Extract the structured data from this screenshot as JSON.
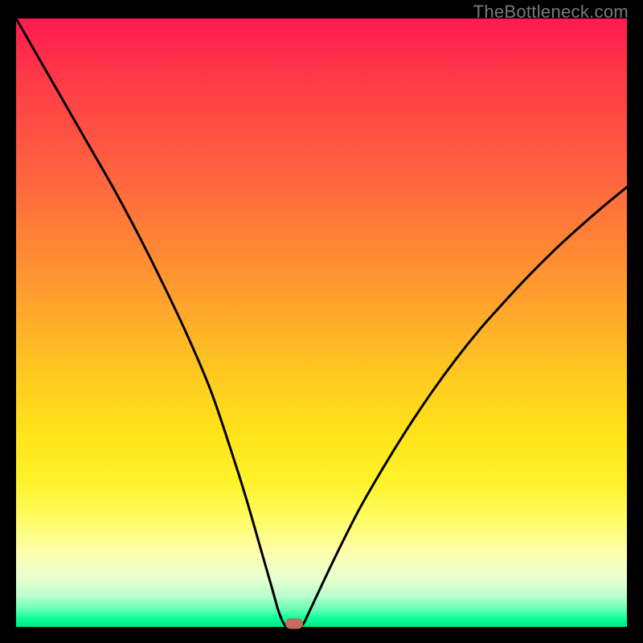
{
  "watermark": "TheBottleneck.com",
  "colors": {
    "curve_stroke": "#000000",
    "marker_fill": "#c86a60",
    "gradient_top": "#ff1a4f",
    "gradient_bottom": "#00e689",
    "frame": "#000000"
  },
  "chart_data": {
    "type": "line",
    "title": "",
    "xlabel": "",
    "ylabel": "",
    "xlim": [
      0,
      100
    ],
    "ylim": [
      0,
      100
    ],
    "grid": false,
    "legend": false,
    "series": [
      {
        "name": "bottleneck-curve",
        "x": [
          0,
          4,
          8,
          12,
          16,
          20,
          24,
          28,
          32,
          36,
          38,
          40,
          42,
          43,
          44,
          45,
          46,
          47,
          48,
          52,
          56,
          60,
          64,
          68,
          72,
          76,
          80,
          84,
          88,
          92,
          96,
          100
        ],
        "values": [
          100,
          93,
          86,
          79,
          72,
          64.5,
          56.5,
          48,
          38.5,
          26.5,
          20,
          13,
          6,
          2.5,
          0.3,
          0.2,
          0.2,
          0.5,
          2.5,
          11,
          19,
          26,
          32.5,
          38.5,
          44,
          49,
          53.5,
          57.8,
          61.8,
          65.5,
          69,
          72.3
        ]
      }
    ],
    "marker": {
      "x": 45.5,
      "y": 0.5
    }
  }
}
